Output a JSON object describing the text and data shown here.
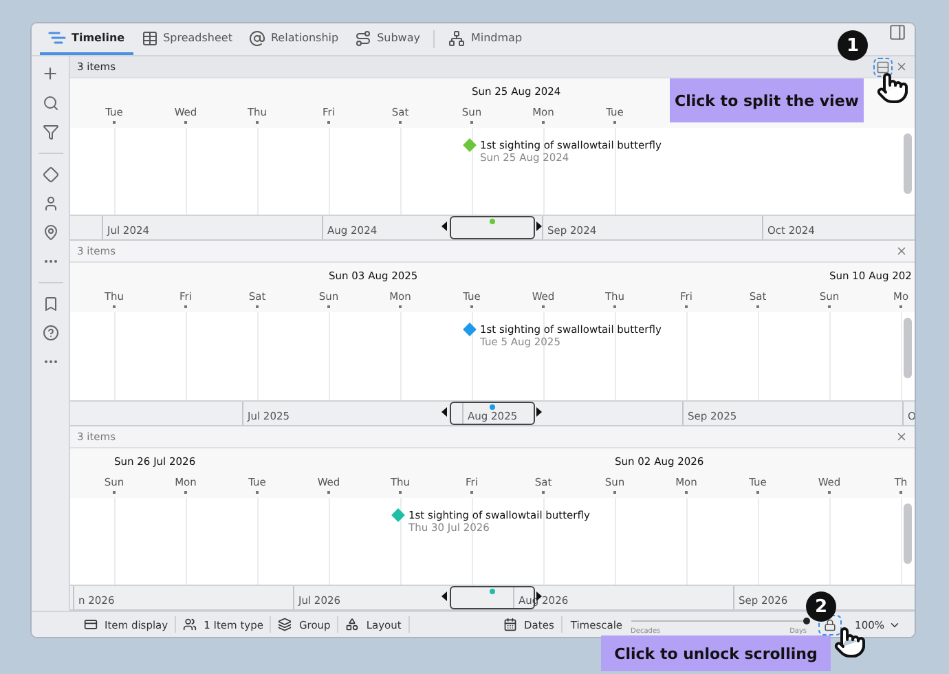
{
  "tabs": [
    {
      "label": "Timeline",
      "selected": true
    },
    {
      "label": "Spreadsheet",
      "selected": false
    },
    {
      "label": "Relationship",
      "selected": false
    },
    {
      "label": "Subway",
      "selected": false
    },
    {
      "label": "Mindmap",
      "selected": false
    }
  ],
  "panes": [
    {
      "count": "3 items",
      "active": true,
      "days": [
        {
          "label": "Tue"
        },
        {
          "label": "Wed"
        },
        {
          "label": "Thu"
        },
        {
          "label": "Fri"
        },
        {
          "label": "Sat"
        },
        {
          "label": "Sun",
          "date_label": "Sun 25 Aug 2024",
          "event": {
            "title": "1st sighting of swallowtail butterfly",
            "date": "Sun 25 Aug 2024",
            "color": "#6cc63a"
          }
        },
        {
          "label": "Mon"
        },
        {
          "label": "Tue"
        }
      ],
      "months": [
        "Jul 2024",
        "Aug 2024",
        "Sep 2024",
        "Oct 2024"
      ]
    },
    {
      "count": "3 items",
      "active": false,
      "days": [
        {
          "label": "Thu"
        },
        {
          "label": "Fri"
        },
        {
          "label": "Sat"
        },
        {
          "label": "Sun",
          "date_label": "Sun 03 Aug 2025"
        },
        {
          "label": "Mon"
        },
        {
          "label": "Tue",
          "event": {
            "title": "1st sighting of swallowtail butterfly",
            "date": "Tue 5 Aug 2025",
            "color": "#1e9be8"
          }
        },
        {
          "label": "Wed"
        },
        {
          "label": "Thu"
        },
        {
          "label": "Fri"
        },
        {
          "label": "Sat"
        },
        {
          "label": "Sun",
          "date_label": "Sun 10 Aug 202"
        },
        {
          "label": "Mo"
        }
      ],
      "months": [
        "Jul 2025",
        "Aug 2025",
        "Sep 2025",
        "O"
      ]
    },
    {
      "count": "3 items",
      "active": false,
      "days": [
        {
          "label": "Sun",
          "date_label": "Sun 26 Jul 2026"
        },
        {
          "label": "Mon"
        },
        {
          "label": "Tue"
        },
        {
          "label": "Wed"
        },
        {
          "label": "Thu",
          "event": {
            "title": "1st sighting of swallowtail butterfly",
            "date": "Thu 30 Jul 2026",
            "color": "#1dbfa5"
          }
        },
        {
          "label": "Fri"
        },
        {
          "label": "Sat"
        },
        {
          "label": "Sun",
          "date_label": "Sun 02 Aug 2026"
        },
        {
          "label": "Mon"
        },
        {
          "label": "Tue"
        },
        {
          "label": "Wed"
        },
        {
          "label": "Th"
        }
      ],
      "months": [
        "n 2026",
        "Jul 2026",
        "Aug 2026",
        "Sep 2026"
      ]
    }
  ],
  "status_bar": {
    "left": [
      "Item display",
      "1 Item type",
      "Group",
      "Layout"
    ],
    "dates": "Dates",
    "timescale": {
      "label": "Timescale",
      "min": "Decades",
      "max": "Days",
      "level": 1.0
    },
    "zoom": "100%"
  },
  "callouts": [
    {
      "step": "1",
      "text": "Click to split the view"
    },
    {
      "step": "2",
      "text": "Click to unlock scrolling"
    }
  ]
}
